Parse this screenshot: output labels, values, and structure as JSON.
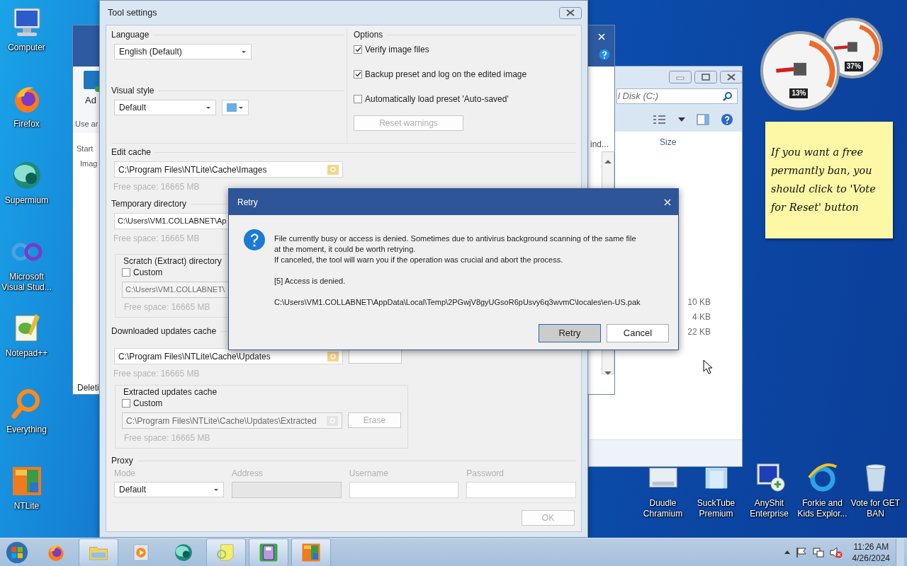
{
  "desktop": {
    "icons_left": [
      {
        "label": "Computer",
        "kind": "computer"
      },
      {
        "label": "Firefox",
        "kind": "firefox"
      },
      {
        "label": "Supermium",
        "kind": "supermium"
      },
      {
        "label": "Microsoft Visual Stud...",
        "kind": "vs"
      },
      {
        "label": "Notepad++",
        "kind": "notepad"
      },
      {
        "label": "Everything",
        "kind": "everything"
      },
      {
        "label": "NTLite",
        "kind": "ntlite"
      }
    ],
    "icons_bottom": [
      {
        "label": "Duudle Chramium",
        "kind": "chromium"
      },
      {
        "label": "SuckTube Premium",
        "kind": "tube"
      },
      {
        "label": "AnyShit Enterprise",
        "kind": "remote"
      },
      {
        "label": "Forkie and Kids Explor...",
        "kind": "ie"
      },
      {
        "label": "Vote for GET BAN",
        "kind": "bin"
      }
    ]
  },
  "gadgets": {
    "cpu_reading": "13%",
    "memory_reading": "37%"
  },
  "sticky_note": {
    "lines": [
      "If you want a free",
      "permantly ban, you",
      "should click to 'Vote",
      "for Reset' button"
    ]
  },
  "background_window": {
    "ribbon_button": "Ad",
    "left_fragments": [
      "Use ar",
      "Start",
      "Imag"
    ],
    "bottom_fragment": "Deleti",
    "right_fragment": "ind..."
  },
  "explorer": {
    "search_placeholder": "l Disk (C:)",
    "column": "Size",
    "sizes": [
      "10 KB",
      "4 KB",
      "22 KB"
    ]
  },
  "tool_settings": {
    "title": "Tool settings",
    "language": {
      "label": "Language",
      "value": "English (Default)"
    },
    "visual_style": {
      "label": "Visual style",
      "value": "Default"
    },
    "options": {
      "label": "Options",
      "checkboxes": [
        {
          "label": "Verify image files",
          "checked": true
        },
        {
          "label": "Backup preset and log on the edited image",
          "checked": true
        },
        {
          "label": "Automatically load preset 'Auto-saved'",
          "checked": false
        }
      ],
      "reset_button": {
        "label": "Reset warnings",
        "disabled": true
      }
    },
    "edit_cache": {
      "label": "Edit cache",
      "field": {
        "value": "C:\\Program Files\\NTLite\\Cache\\Images",
        "disabled": false
      },
      "free_space": "Free space: 16665 MB"
    },
    "temporary_directory": {
      "label": "Temporary directory",
      "field": {
        "value": "C:\\Users\\VM1.COLLABNET\\Ap",
        "disabled": false
      },
      "free_space": "Free space: 16665 MB"
    },
    "scratch_directory": {
      "label": "Scratch (Extract) directory",
      "custom": {
        "label": "Custom",
        "checked": false
      },
      "field": {
        "value": "C:\\Users\\VM1.COLLABNET\\",
        "disabled": true
      },
      "free_space": "Free space: 16665 MB"
    },
    "downloaded_updates": {
      "label": "Downloaded updates cache",
      "field": {
        "value": "C:\\Program Files\\NTLite\\Cache\\Updates",
        "disabled": false
      },
      "free_space": "Free space: 16665 MB"
    },
    "extracted_updates": {
      "label": "Extracted updates cache",
      "custom": {
        "label": "Custom",
        "checked": false
      },
      "field": {
        "value": "C:\\Program Files\\NTLite\\Cache\\Updates\\Extracted",
        "disabled": true
      },
      "button": {
        "label": "Erase",
        "disabled": true
      },
      "free_space": "Free space: 16665 MB"
    },
    "proxy": {
      "label": "Proxy",
      "fields": [
        {
          "label": "Mode",
          "kind": "select",
          "value": "Default",
          "disabled": false
        },
        {
          "label": "Address",
          "kind": "text",
          "disabled": true
        },
        {
          "label": "Username",
          "kind": "text",
          "disabled": false
        },
        {
          "label": "Password",
          "kind": "text",
          "disabled": false
        }
      ]
    },
    "ok_button": {
      "label": "OK",
      "disabled": true
    }
  },
  "dialog": {
    "title": "Retry",
    "message_lines": [
      "File currently busy or access is denied. Sometimes due to antivirus background scanning of the same file",
      "at the moment, it could be worth retrying.",
      "If canceled, the tool will warn you if the operation was crucial and abort the process."
    ],
    "error": "[5] Access is denied.",
    "path": "C:\\Users\\VM1.COLLABNET\\AppData\\Local\\Temp\\2PGwjV8gyUGsoR6pUsvy6q3wvmC\\locales\\en-US.pak",
    "buttons": [
      {
        "label": "Retry",
        "selected": true
      },
      {
        "label": "Cancel",
        "selected": false
      }
    ]
  },
  "taskbar": {
    "items": [
      {
        "kind": "firefox",
        "running": false
      },
      {
        "kind": "explorer",
        "running": true
      },
      {
        "kind": "media",
        "running": false
      },
      {
        "kind": "supermium",
        "running": false
      },
      {
        "kind": "sticky",
        "running": true
      },
      {
        "kind": "greenapp",
        "running": true
      },
      {
        "kind": "ntlite",
        "running": true
      }
    ],
    "clock": {
      "time": "11:26 AM",
      "date": "4/26/2024"
    }
  }
}
